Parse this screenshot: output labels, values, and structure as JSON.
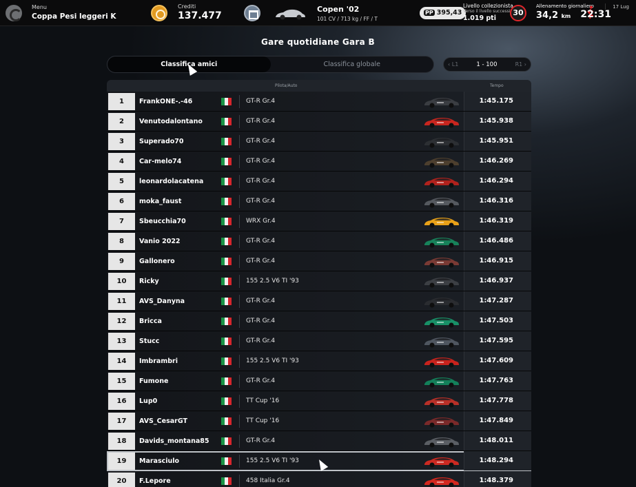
{
  "topbar": {
    "menu_small": "Menu",
    "menu_event": "Coppa Pesi leggeri K",
    "credits_label": "Crediti",
    "credits_value": "137.477",
    "car_name": "Copen '02",
    "car_spec": "101 CV / 713 kg / FF / T",
    "pp_label": "PP",
    "pp_value": "395,43",
    "collector_label": "Livello collezionista",
    "collector_sub": "Verso il livello successivo",
    "collector_value": "1.019 pti",
    "collector_level": "30",
    "daily_label": "Allenamento giornaliero",
    "daily_value": "34,2",
    "daily_unit": "km",
    "clock_time": "22:31",
    "clock_date": "17 Lug"
  },
  "page": {
    "title": "Gare quotidiane Gara B"
  },
  "tabs": [
    {
      "label": "Classifica amici",
      "active": true
    },
    {
      "label": "Classifica globale",
      "active": false
    }
  ],
  "pager": {
    "first": "L1",
    "range": "1 - 100",
    "last": "R1"
  },
  "table": {
    "headers": {
      "driver_car": "Pilota/Auto",
      "time": "Tempo"
    },
    "rows": [
      {
        "pos": "1",
        "driver": "FrankONE-.-46",
        "car": "GT-R Gr.4",
        "time": "1:45.175",
        "color": "#3a3d42"
      },
      {
        "pos": "2",
        "driver": "Venutodalontano",
        "car": "GT-R Gr.4",
        "time": "1:45.938",
        "color": "#c8261f"
      },
      {
        "pos": "3",
        "driver": "Superado70",
        "car": "GT-R Gr.4",
        "time": "1:45.951",
        "color": "#2c2f33"
      },
      {
        "pos": "4",
        "driver": "Car-melo74",
        "car": "GT-R Gr.4",
        "time": "1:46.269",
        "color": "#4d3f2e"
      },
      {
        "pos": "5",
        "driver": "leonardolacatena",
        "car": "GT-R Gr.4",
        "time": "1:46.294",
        "color": "#b0221d"
      },
      {
        "pos": "6",
        "driver": "moka_faust",
        "car": "GT-R Gr.4",
        "time": "1:46.316",
        "color": "#55595f"
      },
      {
        "pos": "7",
        "driver": "Sbeucchia70",
        "car": "WRX Gr.4",
        "time": "1:46.319",
        "color": "#e8a118"
      },
      {
        "pos": "8",
        "driver": "Vanio 2022",
        "car": "GT-R Gr.4",
        "time": "1:46.486",
        "color": "#17825a"
      },
      {
        "pos": "9",
        "driver": "Gallonero",
        "car": "GT-R Gr.4",
        "time": "1:46.915",
        "color": "#7a3a34"
      },
      {
        "pos": "10",
        "driver": "Ricky",
        "car": "155 2.5 V6 TI '93",
        "time": "1:46.937",
        "color": "#3c3f44"
      },
      {
        "pos": "11",
        "driver": "AVS_Danyna",
        "car": "GT-R Gr.4",
        "time": "1:47.287",
        "color": "#2a2c30"
      },
      {
        "pos": "12",
        "driver": "Bricca",
        "car": "GT-R Gr.4",
        "time": "1:47.503",
        "color": "#189067"
      },
      {
        "pos": "13",
        "driver": "Stucc",
        "car": "GT-R Gr.4",
        "time": "1:47.595",
        "color": "#4f5660"
      },
      {
        "pos": "14",
        "driver": "Imbrambri",
        "car": "155 2.5 V6 TI '93",
        "time": "1:47.609",
        "color": "#c9231d"
      },
      {
        "pos": "15",
        "driver": "Fumone",
        "car": "GT-R Gr.4",
        "time": "1:47.763",
        "color": "#13805a"
      },
      {
        "pos": "16",
        "driver": "Lup0",
        "car": "TT Cup '16",
        "time": "1:47.778",
        "color": "#b83028"
      },
      {
        "pos": "17",
        "driver": "AVS_CesarGT",
        "car": "TT Cup '16",
        "time": "1:47.849",
        "color": "#7a2a2a"
      },
      {
        "pos": "18",
        "driver": "Davids_montana85",
        "car": "GT-R Gr.4",
        "time": "1:48.011",
        "color": "#5a5e64"
      },
      {
        "pos": "19",
        "driver": "Marasciulo",
        "car": "155 2.5 V6 TI '93",
        "time": "1:48.294",
        "color": "#cc2a22",
        "selected": true
      },
      {
        "pos": "20",
        "driver": "F.Lepore",
        "car": "458 Italia Gr.4",
        "time": "1:48.379",
        "color": "#d4281f"
      }
    ]
  }
}
